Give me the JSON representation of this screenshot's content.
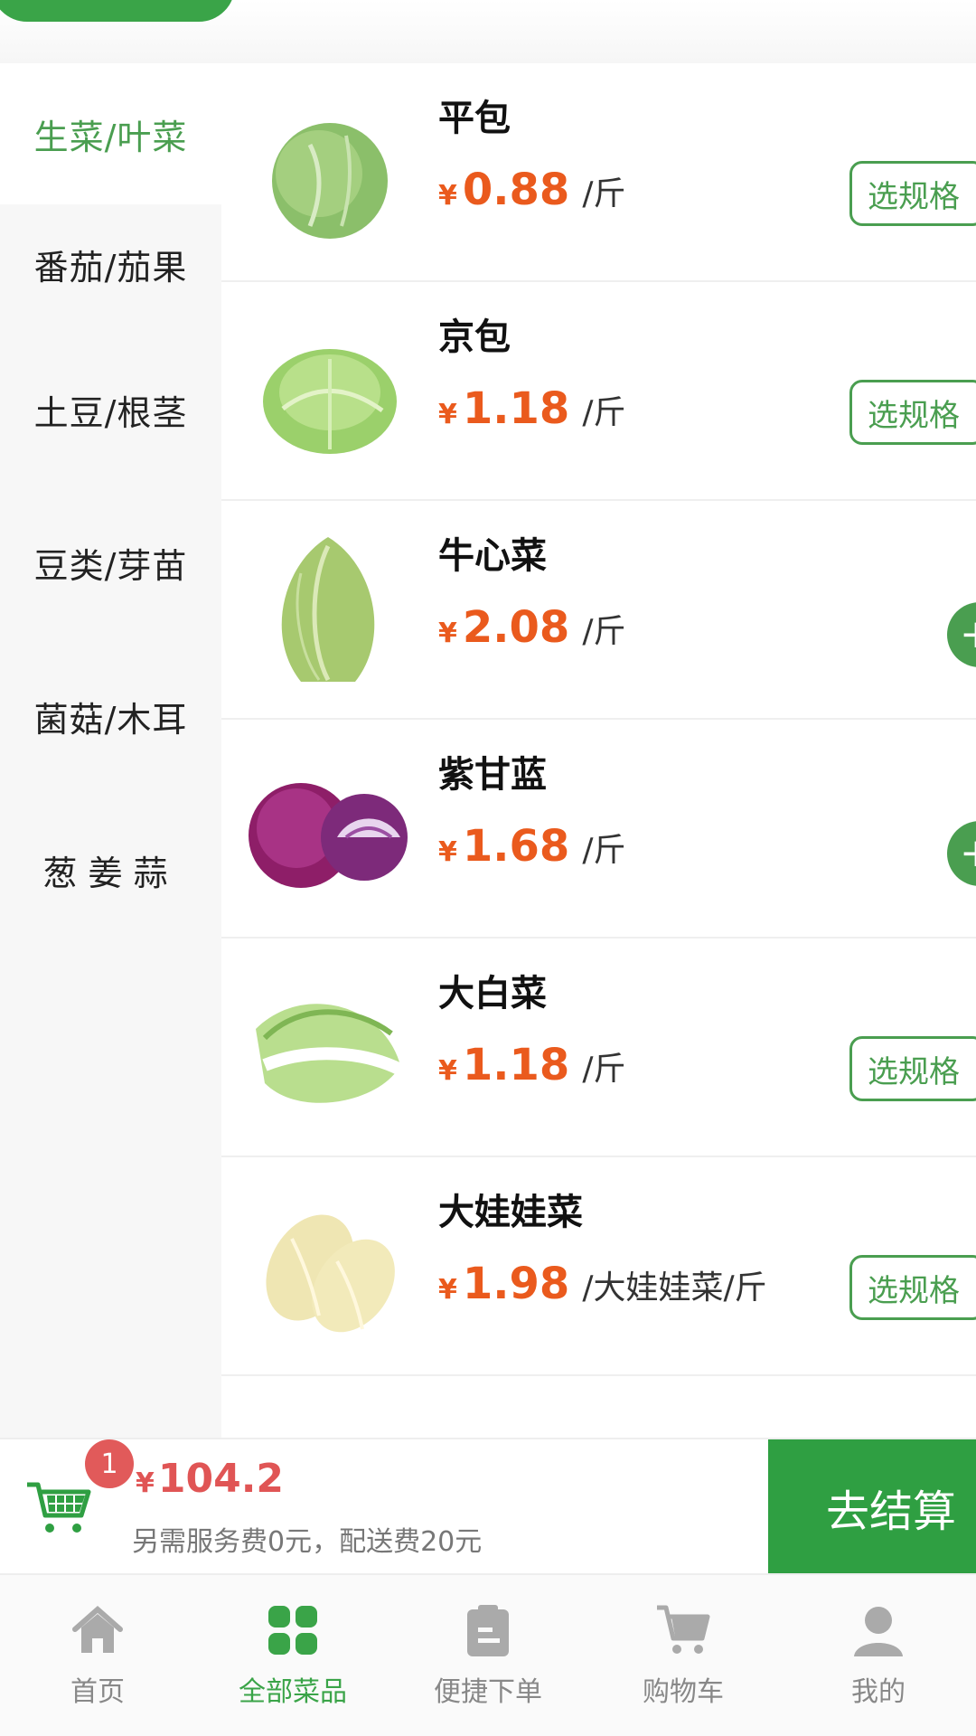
{
  "sidebar": {
    "items": [
      {
        "label": "生菜/叶菜",
        "active": true
      },
      {
        "label": "番茄/茄果",
        "active": false
      },
      {
        "label": "土豆/根茎",
        "active": false
      },
      {
        "label": "豆类/芽苗",
        "active": false
      },
      {
        "label": "菌菇/木耳",
        "active": false
      },
      {
        "label": "葱姜蒜",
        "active": false
      }
    ]
  },
  "products": [
    {
      "name": "平包",
      "currency": "¥",
      "price": "0.88",
      "unit": "/斤",
      "action": "选规格",
      "image": "cabbage"
    },
    {
      "name": "京包",
      "currency": "¥",
      "price": "1.18",
      "unit": "/斤",
      "action": "选规格",
      "image": "cabbage-light"
    },
    {
      "name": "牛心菜",
      "currency": "¥",
      "price": "2.08",
      "unit": "/斤",
      "action": "+",
      "image": "pointed-cabbage"
    },
    {
      "name": "紫甘蓝",
      "currency": "¥",
      "price": "1.68",
      "unit": "/斤",
      "action": "+",
      "image": "red-cabbage"
    },
    {
      "name": "大白菜",
      "currency": "¥",
      "price": "1.18",
      "unit": "/斤",
      "action": "选规格",
      "image": "napa-cabbage"
    },
    {
      "name": "大娃娃菜",
      "currency": "¥",
      "price": "1.98",
      "unit": "/大娃娃菜/斤",
      "action": "选规格",
      "image": "baby-cabbage"
    }
  ],
  "cart": {
    "badge": "1",
    "currency": "¥",
    "total": "104.2",
    "note": "另需服务费0元，配送费20元",
    "checkout_label": "去结算",
    "icon": "cart-icon"
  },
  "bottom_nav": [
    {
      "label": "首页",
      "icon": "home-icon",
      "active": false
    },
    {
      "label": "全部菜品",
      "icon": "grid-icon",
      "active": true
    },
    {
      "label": "便捷下单",
      "icon": "clipboard-icon",
      "active": false
    },
    {
      "label": "购物车",
      "icon": "cart-icon",
      "active": false
    },
    {
      "label": "我的",
      "icon": "user-icon",
      "active": false
    }
  ],
  "colors": {
    "brand_green": "#3aa448",
    "price_orange": "#ea5a1d",
    "badge_red": "#e15a5a",
    "checkout_green": "#2f9f42"
  }
}
